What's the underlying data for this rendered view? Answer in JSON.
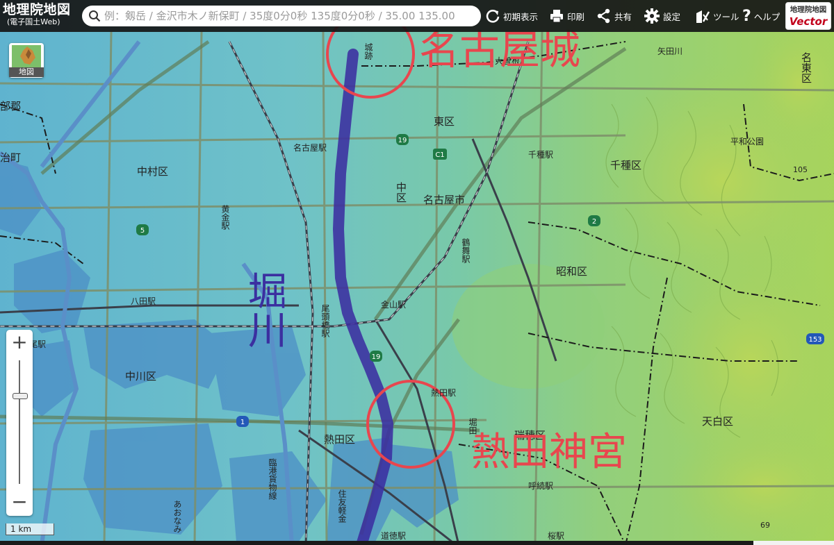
{
  "app": {
    "title": "地理院地図",
    "subtitle": "(電子国土Web)"
  },
  "search": {
    "placeholder": "例：剱岳 / 金沢市木ノ新保町 / 35度0分0秒 135度0分0秒 / 35.00 135.00"
  },
  "toolbar": {
    "reset_label": "初期表示",
    "print_label": "印刷",
    "share_label": "共有",
    "settings_label": "設定",
    "tools_label": "ツール",
    "help_label": "ヘルプ",
    "vector_top": "地理院地図",
    "vector_bottom": "Vector"
  },
  "layer_button": {
    "label": "地図"
  },
  "zoom": {
    "in_label": "+",
    "out_label": "−"
  },
  "scale": {
    "label": "1 km"
  },
  "annotations": {
    "river_label": "堀川",
    "castle_label": "名古屋城",
    "shrine_label": "熱田神宮",
    "circle_color": "#e8464e",
    "river_color": "#3b2fa0"
  },
  "map": {
    "labels": {
      "castle_ruins": "城跡",
      "yada_river": "矢田川",
      "ozone": "大曽根",
      "east_ward": "東区",
      "nagoya_station": "名古屋駅",
      "chikusa_station": "千種駅",
      "heiwa_park": "平和公園",
      "nakamura_ward": "中村区",
      "naka_ward": "中区",
      "chikusa_ward": "千種区",
      "nagoya_city": "名古屋市",
      "kogane_station": "黄金駅",
      "tsurumai_station": "鶴舞駅",
      "showa_ward": "昭和区",
      "hatta_station": "八田駅",
      "kanayama_station": "金山駅",
      "otobashi_station": "尾頭橋駅",
      "nakagawa_ward": "中川区",
      "atsuta_station": "熱田駅",
      "mizuho_ward": "瑞穂区",
      "horita_station": "堀田",
      "atsuta_ward": "熱田区",
      "tempaku_ward": "天白区",
      "yobitsugi_station": "呼続駅",
      "rinko_line": "臨港貨物線",
      "sumitomo": "住友軽金",
      "aonami": "あおなみ",
      "dotoku_station": "道徳駅",
      "sakura_station": "桜駅",
      "meito_ward": "名東区",
      "kitanagoya_district": "部郡",
      "ama_town": "治町",
      "hashira_station": "大尾駅",
      "peak_105": "105",
      "peak_69": "69",
      "route_19": "19",
      "route_19b": "19",
      "route_c1": "C1",
      "route_5": "5",
      "route_2": "2",
      "route_1": "1",
      "route_153": "153"
    },
    "colors": {
      "lowland": "#6fbfd0",
      "sea_level": "#4a8fc6",
      "midland": "#88cfa6",
      "highland": "#9ccf62",
      "hills": "#b6d35a"
    }
  }
}
